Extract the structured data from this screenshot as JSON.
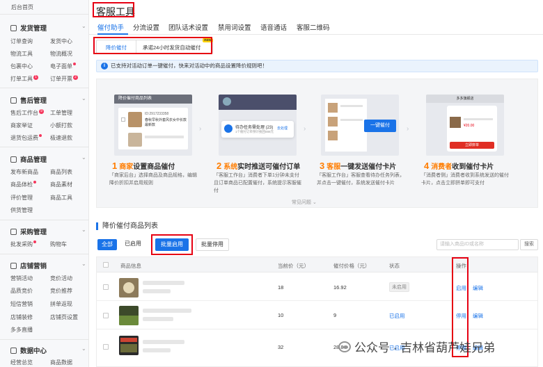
{
  "sidebar": {
    "home": "后台首页",
    "sections": [
      {
        "title": "发货管理",
        "items": [
          "订单查询",
          "发货中心",
          "物流工具",
          "物流概况",
          "包裹中心",
          "电子面单",
          "打单工具",
          "订单开票"
        ]
      },
      {
        "title": "售后管理",
        "items": [
          "售后工作台",
          "工单管理",
          "商家举证",
          "小额打款",
          "退货包运费",
          "极速退款"
        ]
      },
      {
        "title": "商品管理",
        "items": [
          "发布新商品",
          "商品列表",
          "商品体检",
          "商品素材",
          "评价管理",
          "商品工具",
          "供货管理"
        ]
      },
      {
        "title": "采购管理",
        "items": [
          "批发采购",
          "购物车"
        ]
      },
      {
        "title": "店铺营销",
        "items": [
          "营销活动",
          "竞价活动",
          "品质竞价",
          "竞价推荐",
          "短信营销",
          "拼单返现",
          "店铺装修",
          "店铺页设置",
          "多多直播"
        ]
      },
      {
        "title": "数据中心",
        "items": [
          "经营总览",
          "商品数据"
        ]
      }
    ],
    "badges": {
      "after_sale": "9",
      "print_tool": "1",
      "invoice": "2"
    }
  },
  "page": {
    "title": "客服工具"
  },
  "tabs": [
    "催付助手",
    "分流设置",
    "团队话术设置",
    "禁用词设置",
    "语音通话",
    "客服二维码"
  ],
  "subtabs": {
    "a": "降价催付",
    "b": "承诺24小时发货自动催付",
    "new": "new"
  },
  "notice": "已支持对活动订单一键催付，快来对活动中的商品设置降价规则吧！",
  "steps": [
    {
      "num": "1",
      "who": "商家",
      "action": "设置商品催付",
      "desc": "「商家后台」选择商品及商品规格，编辑降价折扣并启用规则"
    },
    {
      "num": "2",
      "who": "系统",
      "action": "实时推送可催付订单",
      "desc": "「客服工作台」消费者下单1分钟未支付且订单商品已配置催付，系统提示客服催付"
    },
    {
      "num": "3",
      "who": "客服",
      "action": "一键发送催付卡片",
      "desc": "「客服工作台」客服查看待办任务列表，并点击一键催付，系统发送催付卡片"
    },
    {
      "num": "4",
      "who": "消费者",
      "action": "收到催付卡片",
      "desc": "「消费者侧」消费者收到系统发送的催付卡片，点击立即拼单即可支付"
    }
  ],
  "step_mock": {
    "s1_header": "降价催付商品列表",
    "s1_id": "ID:2917233358",
    "s1_name1": "春秋早秋外套风衣女中长款",
    "s1_name2": "最新款",
    "s2_task": "待办任务需处理 (23)",
    "s2_sub": "1个催付订单预计挽回888元",
    "s2_link": "去处理",
    "s3_btn": "一键催付",
    "s4_header": "多多旗舰店",
    "s4_btn": "立即拼单",
    "s4_price": "¥20.00"
  },
  "faq": "常见问题",
  "list": {
    "title": "降价催付商品列表",
    "filters": [
      "全部",
      "已启用"
    ],
    "batch_enable": "批量启用",
    "batch_disable": "批量停用",
    "search_placeholder": "请输入商品ID或名称",
    "search_btn": "搜索",
    "columns": [
      "商品信息",
      "当前价（元）",
      "催付价格（元）",
      "状态",
      "操作"
    ],
    "rows": [
      {
        "price": "18",
        "urge": "16.92",
        "status": "未启用",
        "op1": "启用",
        "op2": "编辑"
      },
      {
        "price": "10",
        "urge": "9",
        "status": "已启用",
        "op1": "停用",
        "op2": "编辑"
      },
      {
        "price": "32",
        "urge": "28.8",
        "status": "已启用",
        "op1": "停用",
        "op2": "编辑"
      }
    ]
  },
  "watermark": "公众号 · 吉林省葫芦娃兄弟",
  "colors": {
    "accent": "#1a73e8",
    "highlight": "#e60012",
    "orange": "#ff7d00"
  }
}
